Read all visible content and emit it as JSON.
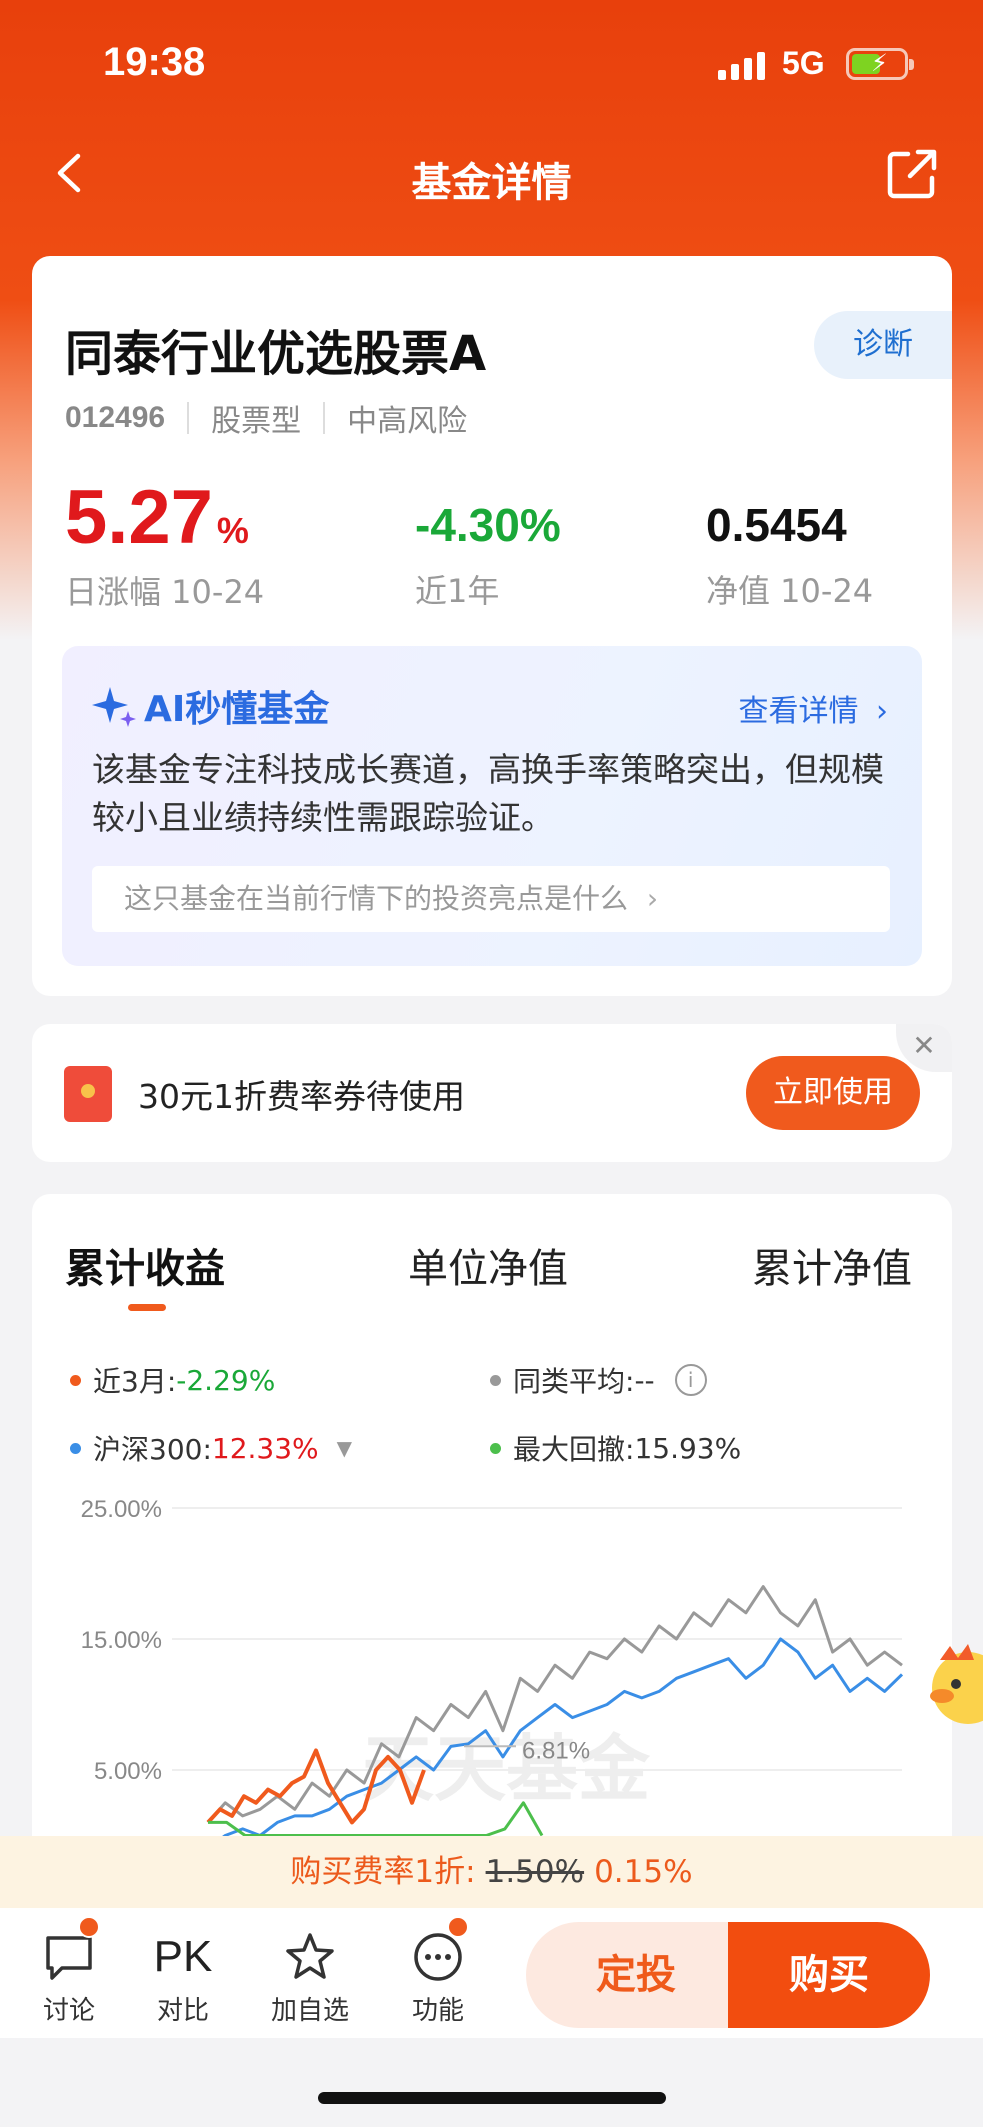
{
  "status_bar": {
    "time": "19:38",
    "network": "5G"
  },
  "nav": {
    "title": "基金详情"
  },
  "fund": {
    "name": "同泰行业优选股票A",
    "code": "012496",
    "type": "股票型",
    "risk": "中高风险",
    "diagnose_label": "诊断",
    "daily_change_value": "5.27",
    "daily_change_unit": "%",
    "daily_change_label": "日涨幅 10-24",
    "one_year_value": "-4.30%",
    "one_year_label": "近1年",
    "nav_value": "0.5454",
    "nav_label": "净值 10-24"
  },
  "ai": {
    "title": "AI秒懂基金",
    "more": "查看详情",
    "summary": "该基金专注科技成长赛道，高换手率策略突出，但规模较小且业绩持续性需跟踪验证。",
    "question": "这只基金在当前行情下的投资亮点是什么"
  },
  "coupon": {
    "text": "30元1折费率券待使用",
    "button": "立即使用"
  },
  "chart_tabs": [
    "累计收益",
    "单位净值",
    "累计净值"
  ],
  "legend": {
    "near3m_label": "近3月:",
    "near3m_value": "-2.29%",
    "peer_label": "同类平均:",
    "peer_value": "--",
    "hs300_label": "沪深300:",
    "hs300_value": "12.33%",
    "drawdown_label": "最大回撤:",
    "drawdown_value": "15.93%"
  },
  "colors": {
    "brand": "#f05a1d",
    "fund_line": "#f05a1d",
    "hs300_line": "#3a8ee6",
    "peer_line": "#999999",
    "drawdown_line": "#4cbf4c",
    "up": "#e0191c",
    "down": "#1aa838"
  },
  "chart_data": {
    "type": "line",
    "y_ticks": [
      "25.00%",
      "15.00%",
      "5.00%"
    ],
    "ylim": [
      -2,
      25
    ],
    "annotation": "6.81%",
    "watermark": "天天基金",
    "series": [
      {
        "values": [
          1,
          2,
          1.5,
          3,
          2.5,
          3.5,
          3,
          4,
          4.5,
          6.5,
          4,
          2.5,
          1,
          2,
          5,
          6,
          5,
          2.5,
          5
        ]
      },
      {
        "values": [
          -1,
          0,
          0.5,
          0,
          1,
          1.5,
          1.5,
          2,
          3,
          3.5,
          4,
          5,
          6,
          5,
          6.8,
          7,
          8,
          6,
          8,
          9,
          10,
          9,
          9.5,
          10,
          11,
          10.5,
          11,
          12,
          12.5,
          13,
          13.5,
          12,
          13,
          15,
          14,
          12,
          13,
          11,
          12,
          11,
          12.3
        ]
      },
      {
        "values": [
          1,
          2.5,
          1.5,
          2,
          3,
          2,
          4,
          3,
          5,
          4,
          7,
          6,
          9,
          8,
          10,
          9,
          11,
          8,
          12,
          11,
          13,
          12,
          14,
          13.5,
          15,
          14,
          16,
          15,
          17,
          16,
          18,
          17,
          19,
          17,
          16,
          18,
          14,
          15,
          13,
          14,
          13
        ]
      },
      {
        "values": [
          1,
          1,
          0,
          0,
          0,
          0,
          0,
          0,
          0,
          0,
          0,
          0,
          0,
          0,
          0,
          0,
          0.5,
          2.5,
          0
        ]
      }
    ]
  },
  "fee": {
    "prefix": "购买费率1折:",
    "old_rate": "1.50%",
    "new_rate": "0.15%"
  },
  "bottom_nav": {
    "discuss": "讨论",
    "compare_icon": "PK",
    "compare": "对比",
    "watch": "加自选",
    "functions": "功能",
    "invest": "定投",
    "buy": "购买"
  }
}
